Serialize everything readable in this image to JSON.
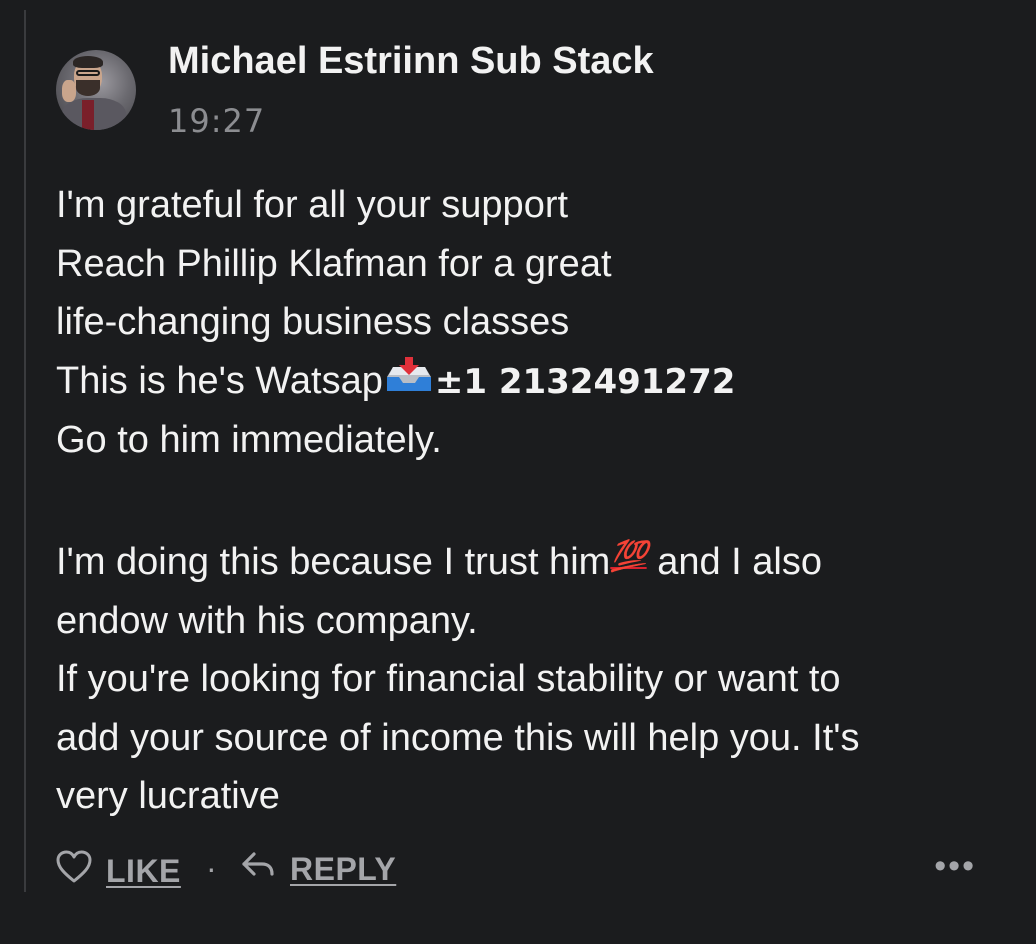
{
  "comment": {
    "author": "Michael Estriinn Sub Stack",
    "timestamp": "19:27",
    "lines": [
      "I'm grateful for all your support",
      "Reach Phillip Klafman for a great",
      "life-changing business classes",
      "This is he's Watsap",
      "±1  2132491272",
      "Go to him immediately.",
      "I'm doing this because I trust him",
      "💯",
      " and I also",
      "endow with his company.",
      "If you're looking for financial stability or want to",
      "add your source of income this will help you. It's",
      "very lucrative"
    ]
  },
  "actions": {
    "like_label": "LIKE",
    "separator": "·",
    "reply_label": "REPLY",
    "more_label": "•••"
  },
  "icons": {
    "like": "heart-outline-icon",
    "reply": "reply-arrow-icon",
    "inbox": "inbox-tray-emoji-icon",
    "hundred": "hundred-points-emoji-icon"
  },
  "colors": {
    "background": "#1b1c1e",
    "text": "#f2f2f2",
    "muted": "#a4a5a9",
    "timestamp": "#8c8d91",
    "hundred": "#d8222e",
    "thread_line": "#3a3b3e"
  }
}
